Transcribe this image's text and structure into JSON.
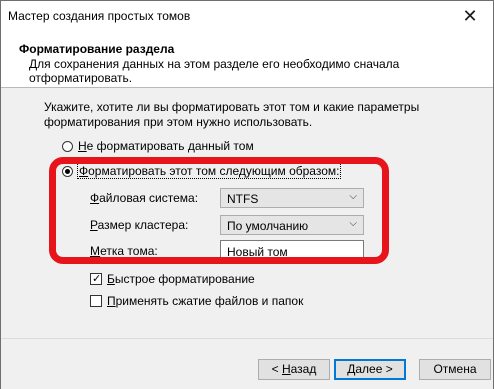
{
  "window": {
    "title": "Мастер создания простых томов",
    "close_glyph": "✕"
  },
  "header": {
    "title": "Форматирование раздела",
    "subtitle": "Для сохранения данных на этом разделе его необходимо сначала отформатировать."
  },
  "body": {
    "intro": "Укажите, хотите ли вы форматировать этот том и какие параметры форматирования при этом нужно использовать.",
    "radio_no_format": {
      "mnemonic": "Н",
      "rest": "е форматировать данный том",
      "checked": false
    },
    "radio_format": {
      "mnemonic": "Ф",
      "rest": "орматировать этот том следующим образом:",
      "checked": true
    },
    "filesystem": {
      "label_mnemonic": "Ф",
      "label_rest": "айловая система:",
      "value": "NTFS"
    },
    "cluster": {
      "label_mnemonic": "Р",
      "label_rest": "азмер кластера:",
      "value": "По умолчанию"
    },
    "volume_label": {
      "label_mnemonic": "М",
      "label_rest": "етка тома:",
      "value": "Новый том"
    },
    "quick_format": {
      "mnemonic": "Б",
      "rest": "ыстрое форматирование",
      "checked": true
    },
    "compression": {
      "mnemonic": "П",
      "rest": "рименять сжатие файлов и папок",
      "checked": false
    }
  },
  "footer": {
    "back": {
      "prefix": "< ",
      "mnemonic": "Н",
      "rest": "азад"
    },
    "next": {
      "mnemonic": "Д",
      "rest": "алее >"
    },
    "cancel": "Отмена"
  },
  "colors": {
    "highlight": "#e8141c",
    "primary_border": "#0078d7"
  }
}
